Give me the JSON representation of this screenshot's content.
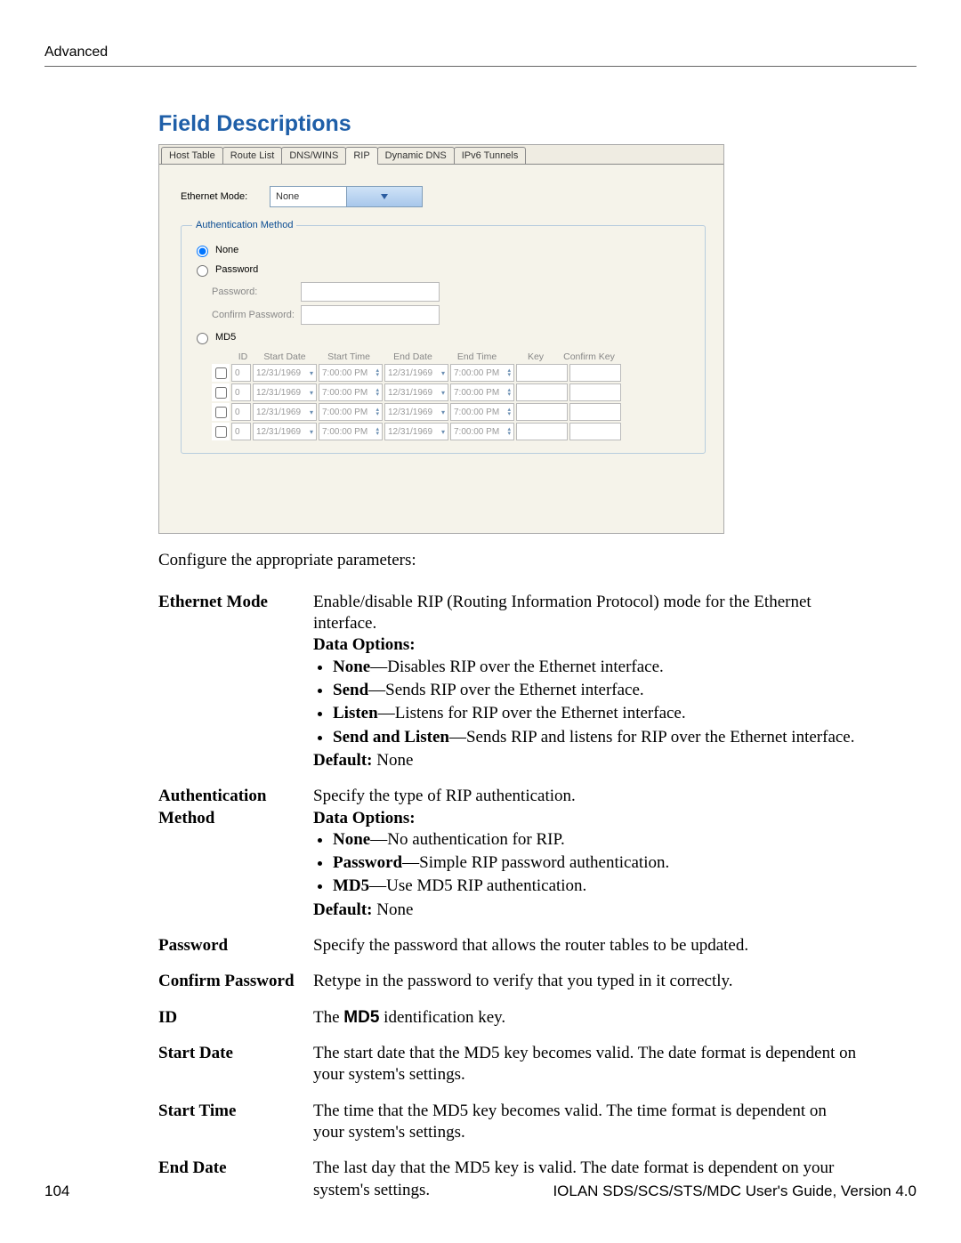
{
  "header": {
    "title": "Advanced"
  },
  "section": {
    "title": "Field Descriptions"
  },
  "dialog": {
    "tabs": [
      "Host Table",
      "Route List",
      "DNS/WINS",
      "RIP",
      "Dynamic DNS",
      "IPv6 Tunnels"
    ],
    "active_tab": "RIP",
    "ethernet_mode_label": "Ethernet Mode:",
    "ethernet_mode_value": "None",
    "auth_legend": "Authentication Method",
    "radio_none": "None",
    "radio_password": "Password",
    "password_label": "Password:",
    "confirm_password_label": "Confirm Password:",
    "radio_md5": "MD5",
    "md5_headers": {
      "id": "ID",
      "start_date": "Start Date",
      "start_time": "Start Time",
      "end_date": "End Date",
      "end_time": "End Time",
      "key": "Key",
      "confirm_key": "Confirm Key"
    },
    "md5_rows": [
      {
        "id": "0",
        "start_date": "12/31/1969",
        "start_time": "7:00:00 PM",
        "end_date": "12/31/1969",
        "end_time": "7:00:00 PM"
      },
      {
        "id": "0",
        "start_date": "12/31/1969",
        "start_time": "7:00:00 PM",
        "end_date": "12/31/1969",
        "end_time": "7:00:00 PM"
      },
      {
        "id": "0",
        "start_date": "12/31/1969",
        "start_time": "7:00:00 PM",
        "end_date": "12/31/1969",
        "end_time": "7:00:00 PM"
      },
      {
        "id": "0",
        "start_date": "12/31/1969",
        "start_time": "7:00:00 PM",
        "end_date": "12/31/1969",
        "end_time": "7:00:00 PM"
      }
    ]
  },
  "narrative": {
    "intro": "Configure the appropriate parameters:"
  },
  "fields": {
    "ethernet_mode": {
      "term": "Ethernet Mode",
      "desc": "Enable/disable RIP (Routing Information Protocol) mode for the Ethernet interface.",
      "data_options_label": "Data Options:",
      "options": [
        {
          "k": "None",
          "v": "—Disables RIP over the Ethernet interface."
        },
        {
          "k": "Send",
          "v": "—Sends RIP over the Ethernet interface."
        },
        {
          "k": "Listen",
          "v": "—Listens for RIP over the Ethernet interface."
        },
        {
          "k": "Send and Listen",
          "v": "—Sends RIP and listens for RIP over the Ethernet interface."
        }
      ],
      "default_label": "Default:",
      "default_value": " None"
    },
    "auth_method": {
      "term": "Authentication Method",
      "desc": "Specify the type of RIP authentication.",
      "data_options_label": "Data Options:",
      "options": [
        {
          "k": "None",
          "v": "—No authentication for RIP."
        },
        {
          "k": "Password",
          "v": "—Simple RIP password authentication."
        },
        {
          "k": "MD5",
          "v": "—Use MD5 RIP authentication."
        }
      ],
      "default_label": "Default:",
      "default_value": " None"
    },
    "password": {
      "term": "Password",
      "desc": "Specify the password that allows the router tables to be updated."
    },
    "confirm_password": {
      "term": "Confirm Password",
      "desc": "Retype in the password to verify that you typed in it correctly."
    },
    "id": {
      "term": "ID",
      "prefix": "The ",
      "bold": "MD5",
      "suffix": " identification key."
    },
    "start_date": {
      "term": "Start Date",
      "desc": "The start date that the MD5 key becomes valid. The date format is dependent on your system's settings."
    },
    "start_time": {
      "term": "Start Time",
      "desc": "The time that the MD5 key becomes valid. The time format is dependent on your system's settings."
    },
    "end_date": {
      "term": "End Date",
      "desc": "The last day that the MD5 key is valid. The date format is dependent on your system's settings."
    }
  },
  "footer": {
    "page": "104",
    "doc": "IOLAN SDS/SCS/STS/MDC User's Guide, Version 4.0"
  }
}
